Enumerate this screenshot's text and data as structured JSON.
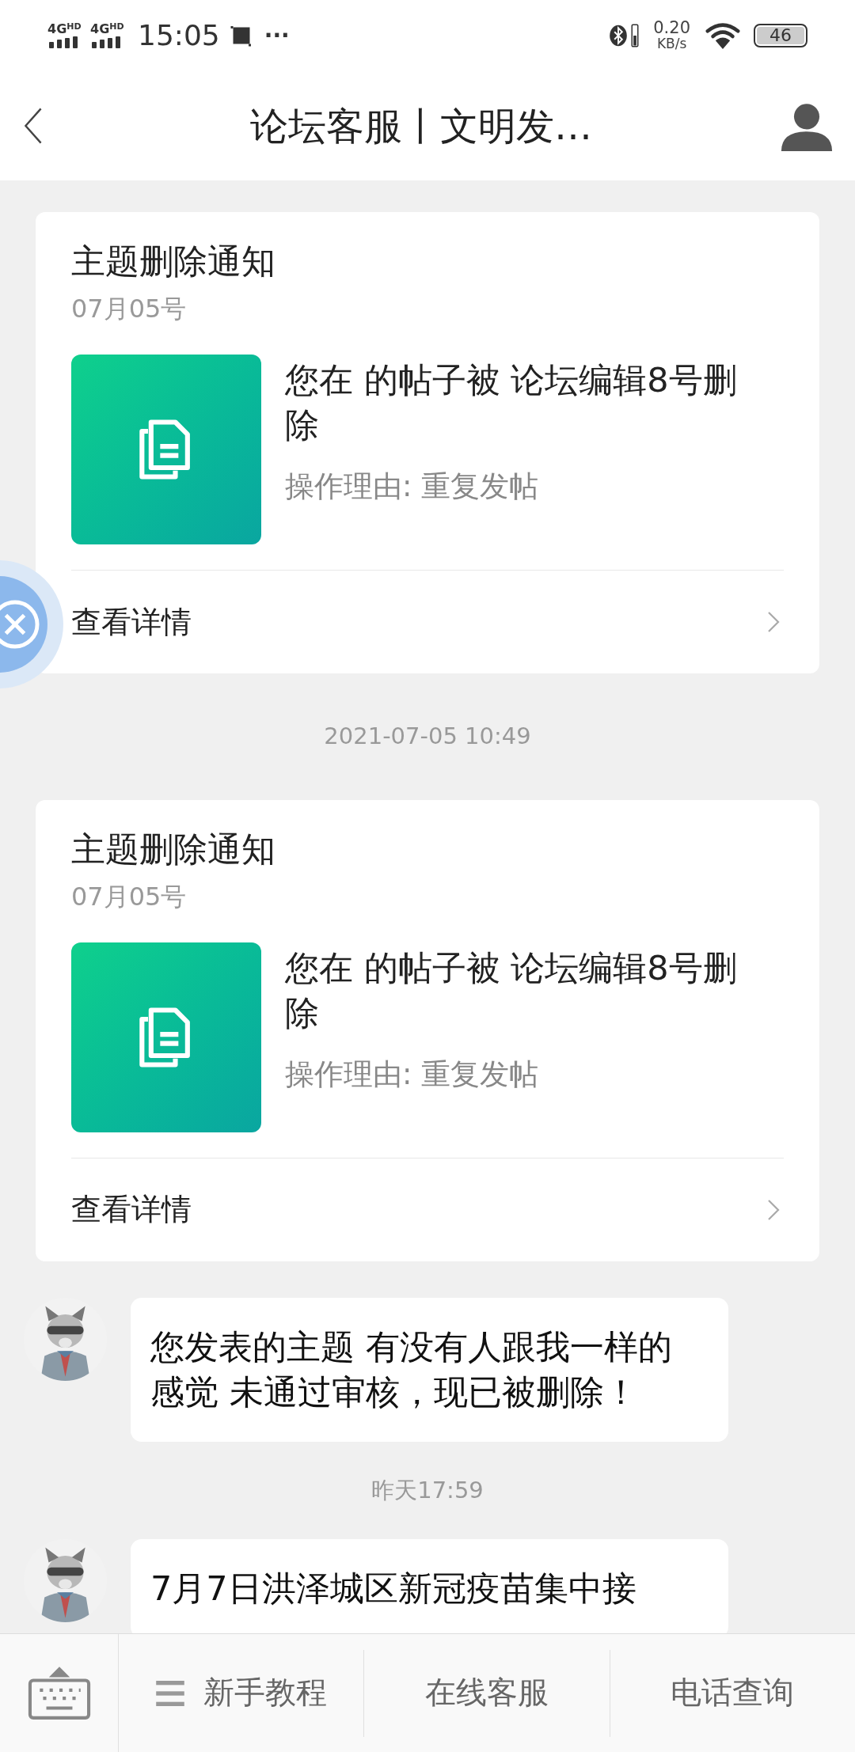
{
  "status_bar": {
    "network_1": "4G",
    "network_1_badge": "HD",
    "network_2": "4G",
    "network_2_badge": "HD",
    "time": "15:05",
    "more": "···",
    "speed_value": "0.20",
    "speed_unit": "KB/s",
    "battery": "46"
  },
  "header": {
    "title": "论坛客服丨文明发…"
  },
  "messages": [
    {
      "kind": "card",
      "title": "主题删除通知",
      "date": "07月05号",
      "text": "您在 的帖子被 论坛编辑8号删除",
      "reason": "操作理由: 重复发帖",
      "link": "查看详情"
    },
    {
      "kind": "time",
      "text": "2021-07-05 10:49"
    },
    {
      "kind": "card",
      "title": "主题删除通知",
      "date": "07月05号",
      "text": "您在 的帖子被 论坛编辑8号删除",
      "reason": "操作理由: 重复发帖",
      "link": "查看详情"
    },
    {
      "kind": "bubble",
      "text": "您发表的主题 有没有人跟我一样的感觉 未通过审核，现已被删除！"
    },
    {
      "kind": "time",
      "text": "昨天17:59"
    },
    {
      "kind": "bubble",
      "text": "7月7日洪泽城区新冠疫苗集中接"
    }
  ],
  "bottom_bar": {
    "items": [
      {
        "label": "新手教程",
        "menu": true
      },
      {
        "label": "在线客服",
        "menu": false
      },
      {
        "label": "电话查询",
        "menu": false
      }
    ]
  }
}
